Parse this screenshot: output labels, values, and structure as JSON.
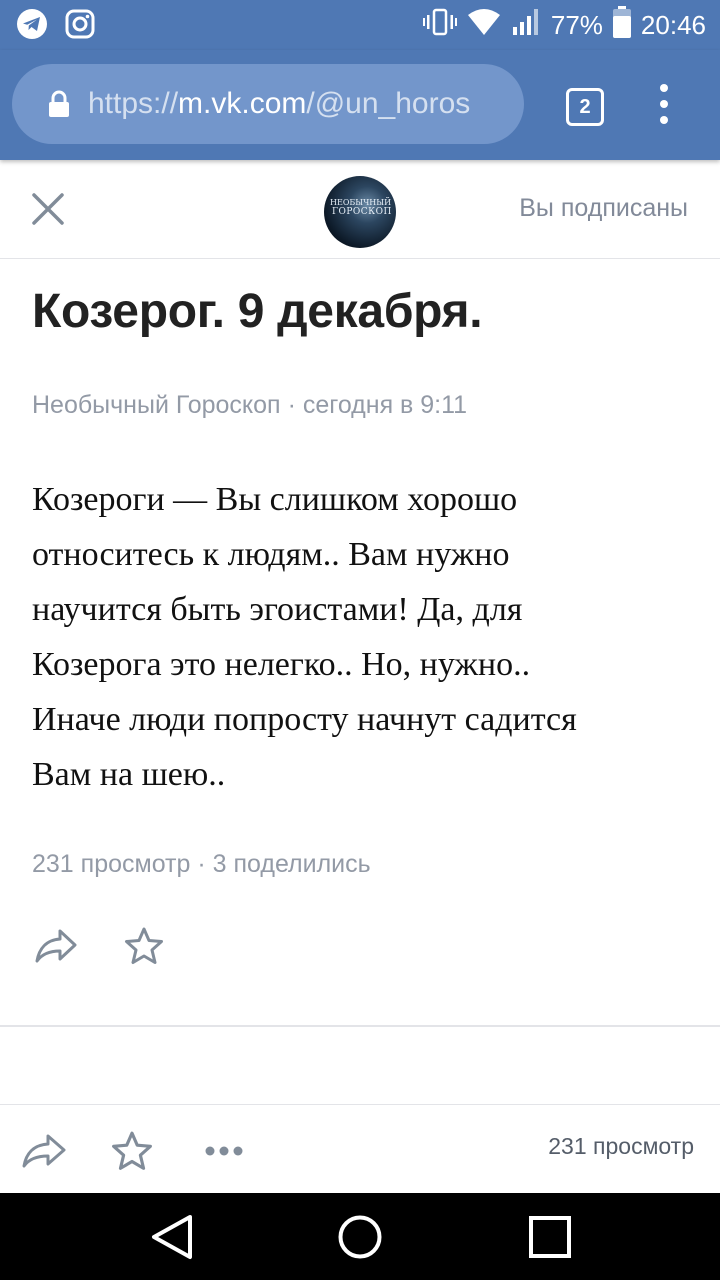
{
  "status_bar": {
    "battery": "77%",
    "time": "20:46"
  },
  "browser": {
    "url_scheme": "https://",
    "url_host": "m.vk.com",
    "url_path": "/@un_horos",
    "tab_count": "2"
  },
  "header": {
    "avatar_line1": "НЕОБЫЧНЫЙ",
    "avatar_line2": "ГОРОСКОП",
    "subscribed_label": "Вы подписаны"
  },
  "article": {
    "title": "Козерог. 9 декабря.",
    "author": "Необычный Гороскоп",
    "separator": "·",
    "date": "сегодня в 9:11",
    "body_lines": [
      "Козероги — Вы слишком хорошо",
      "относитесь к людям.. Вам нужно",
      "научится быть эгоистами! Да, для",
      "Козерога это нелегко.. Но, нужно..",
      "Иначе люди попросту начнут садится",
      "Вам на шею.."
    ],
    "views": "231 просмотр",
    "shares": "3 поделились"
  },
  "bottom_bar": {
    "views": "231 просмотр"
  },
  "icons": [
    "telegram-icon",
    "instagram-icon",
    "vibrate-icon",
    "wifi-icon",
    "signal-icon",
    "battery-icon",
    "lock-icon",
    "close-icon",
    "share-icon",
    "star-icon",
    "more-icon",
    "back-icon",
    "home-icon",
    "recents-icon"
  ],
  "colors": {
    "brand_blue": "#4f78b4",
    "url_pill": "#7396cb",
    "muted_text": "#939aa6",
    "icon_gray": "#818c99"
  }
}
